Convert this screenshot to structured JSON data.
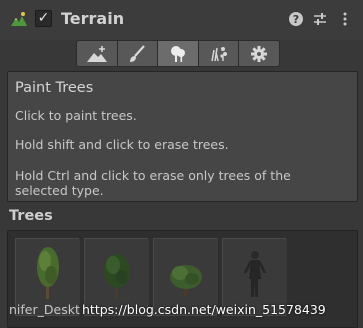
{
  "header": {
    "title": "Terrain",
    "enabled": true,
    "icons": [
      "terrain-icon",
      "help-icon",
      "settings-sliders-icon",
      "more-options-icon"
    ]
  },
  "toolbar": {
    "tools": [
      {
        "name": "raise-lower-terrain-icon",
        "active": false
      },
      {
        "name": "paint-brush-icon",
        "active": false
      },
      {
        "name": "paint-trees-icon",
        "active": true
      },
      {
        "name": "paint-details-icon",
        "active": false
      },
      {
        "name": "terrain-settings-gear-icon",
        "active": false
      }
    ]
  },
  "help": {
    "title": "Paint Trees",
    "line1": "Click to paint trees.",
    "line2": "Hold shift and click to erase trees.",
    "line3": "Hold Ctrl and click to erase only trees of the selected type."
  },
  "trees": {
    "label": "Trees",
    "caption_visible": "nifer_Deskt",
    "watermark": "https://blog.csdn.net/weixin_51578439"
  },
  "colors": {
    "bg": "#383838",
    "panel": "#464646",
    "active_tool": "#6c6c6c"
  }
}
